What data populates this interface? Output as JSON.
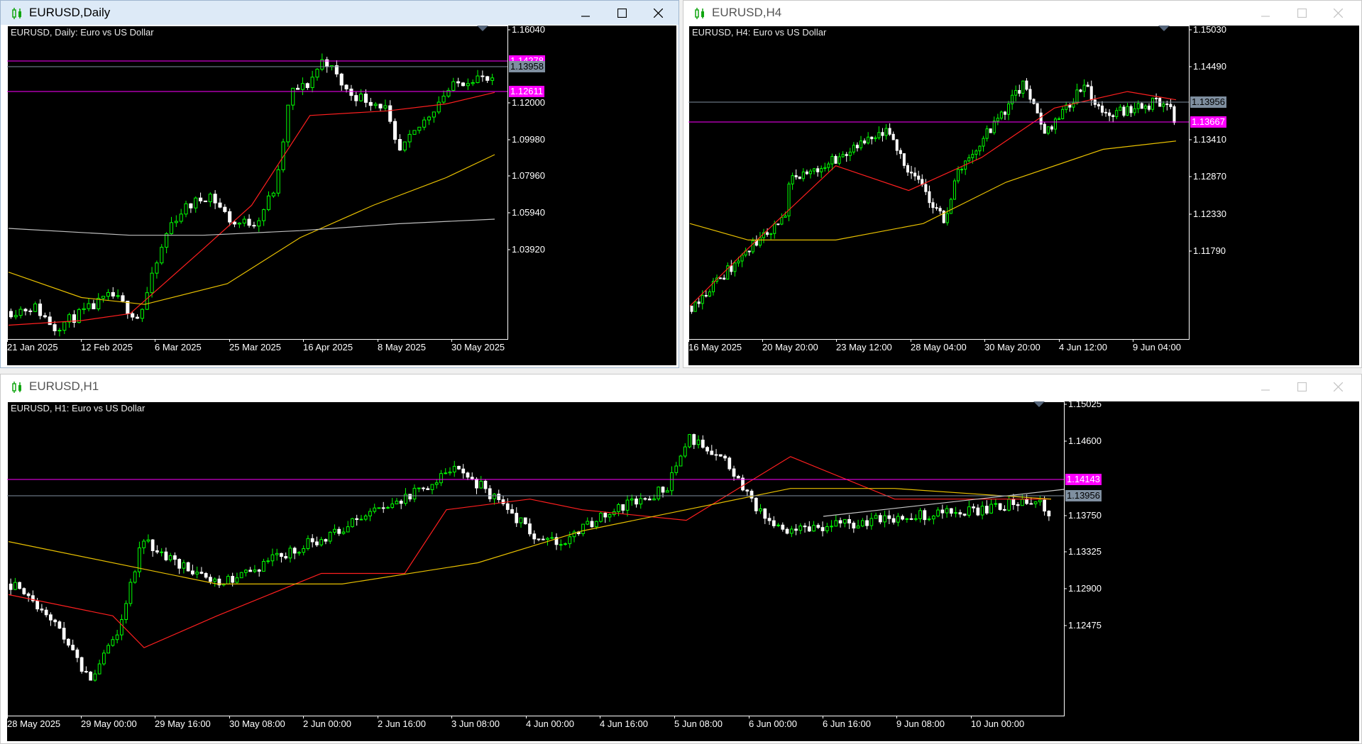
{
  "windows": [
    {
      "id": "daily",
      "state": "active",
      "title": "EURUSD,Daily",
      "chart_title": "EURUSD, Daily:  Euro vs US Dollar",
      "price_labels": [
        "1.16040",
        "1.12000",
        "1.09980",
        "1.07960",
        "1.05940",
        "1.03920"
      ],
      "time_labels": [
        "21 Jan 2025",
        "12 Feb 2025",
        "6 Mar 2025",
        "25 Mar 2025",
        "16 Apr 2025",
        "8 May 2025",
        "30 May 2025"
      ],
      "hlines": [
        {
          "label": "1.14278",
          "color": "#ff00ff"
        },
        {
          "label": "1.13958",
          "color": "#7f8fa0"
        },
        {
          "label": "1.12611",
          "color": "#ff00ff"
        }
      ]
    },
    {
      "id": "h4",
      "state": "inactive",
      "title": "EURUSD,H4",
      "chart_title": "EURUSD, H4:  Euro vs US Dollar",
      "price_labels": [
        "1.15030",
        "1.14490",
        "1.13410",
        "1.12870",
        "1.12330",
        "1.11790"
      ],
      "time_labels": [
        "16 May 2025",
        "20 May 20:00",
        "23 May 12:00",
        "28 May 04:00",
        "30 May 20:00",
        "4 Jun 12:00",
        "9 Jun 04:00"
      ],
      "hlines": [
        {
          "label": "1.13956",
          "color": "#7f8fa0"
        },
        {
          "label": "1.13667",
          "color": "#ff00ff"
        }
      ]
    },
    {
      "id": "h1",
      "state": "inactive",
      "title": "EURUSD,H1",
      "chart_title": "EURUSD, H1:  Euro vs US Dollar",
      "price_labels": [
        "1.15025",
        "1.14600",
        "1.13750",
        "1.13325",
        "1.12900",
        "1.12475"
      ],
      "time_labels": [
        "28 May 2025",
        "29 May 00:00",
        "29 May 16:00",
        "30 May 08:00",
        "2 Jun 00:00",
        "2 Jun 16:00",
        "3 Jun 08:00",
        "4 Jun 00:00",
        "4 Jun 16:00",
        "5 Jun 08:00",
        "6 Jun 00:00",
        "6 Jun 16:00",
        "9 Jun 08:00",
        "10 Jun 00:00"
      ],
      "hlines": [
        {
          "label": "1.14143",
          "color": "#ff00ff"
        },
        {
          "label": "1.13956",
          "color": "#7f8fa0"
        }
      ]
    }
  ],
  "colors": {
    "bull_candle": "#00ff00",
    "bear_candle": "#ffffff",
    "ma_fast": "#ff1f1f",
    "ma_mid": "#e8c000",
    "ma_slow": "#bfbfbf",
    "chart_bg": "#000000",
    "trendline": "#c8c8c8"
  },
  "icons": {
    "app_icon": "candlestick-chart-icon",
    "minimize": "minimize-icon",
    "maximize": "maximize-icon",
    "close": "close-icon"
  },
  "chart_data": [
    {
      "type": "line",
      "chart_kind": "candlestick",
      "symbol": "EURUSD",
      "timeframe": "Daily",
      "title": "EURUSD, Daily:  Euro vs US Dollar",
      "x_range": [
        "21 Jan 2025",
        "9 Jun 2025"
      ],
      "ylim": [
        1.029,
        1.165
      ],
      "close_path": [
        [
          "21 Jan 2025",
          1.041
        ],
        [
          "28 Jan 2025",
          1.043
        ],
        [
          "3 Feb 2025",
          1.034
        ],
        [
          "12 Feb 2025",
          1.041
        ],
        [
          "20 Feb 2025",
          1.048
        ],
        [
          "28 Feb 2025",
          1.038
        ],
        [
          "6 Mar 2025",
          1.078
        ],
        [
          "10 Mar 2025",
          1.085
        ],
        [
          "18 Mar 2025",
          1.092
        ],
        [
          "25 Mar 2025",
          1.079
        ],
        [
          "1 Apr 2025",
          1.08
        ],
        [
          "7 Apr 2025",
          1.096
        ],
        [
          "11 Apr 2025",
          1.136
        ],
        [
          "16 Apr 2025",
          1.139
        ],
        [
          "21 Apr 2025",
          1.151
        ],
        [
          "28 Apr 2025",
          1.136
        ],
        [
          "8 May 2025",
          1.13
        ],
        [
          "12 May 2025",
          1.109
        ],
        [
          "20 May 2025",
          1.124
        ],
        [
          "26 May 2025",
          1.136
        ],
        [
          "30 May 2025",
          1.14
        ],
        [
          "4 Jun 2025",
          1.143
        ],
        [
          "9 Jun 2025",
          1.14
        ]
      ],
      "series": [
        {
          "name": "MA fast (red)",
          "color": "#ff1f1f",
          "values": [
            [
              0,
              1.035
            ],
            [
              0.15,
              1.037
            ],
            [
              0.25,
              1.04
            ],
            [
              0.4,
              1.068
            ],
            [
              0.5,
              1.087
            ],
            [
              0.62,
              1.126
            ],
            [
              0.78,
              1.128
            ],
            [
              0.9,
              1.131
            ],
            [
              1.0,
              1.136
            ]
          ]
        },
        {
          "name": "MA mid (yellow)",
          "color": "#e8c000",
          "values": [
            [
              0,
              1.058
            ],
            [
              0.15,
              1.047
            ],
            [
              0.28,
              1.044
            ],
            [
              0.45,
              1.053
            ],
            [
              0.6,
              1.073
            ],
            [
              0.75,
              1.087
            ],
            [
              0.9,
              1.099
            ],
            [
              1.0,
              1.109
            ]
          ]
        },
        {
          "name": "MA slow (gray)",
          "color": "#bfbfbf",
          "values": [
            [
              0,
              1.077
            ],
            [
              0.25,
              1.074
            ],
            [
              0.4,
              1.074
            ],
            [
              0.6,
              1.076
            ],
            [
              0.8,
              1.079
            ],
            [
              1.0,
              1.081
            ]
          ]
        }
      ],
      "horizontal_lines": [
        1.14278,
        1.13958,
        1.12611
      ]
    },
    {
      "type": "line",
      "chart_kind": "candlestick",
      "symbol": "EURUSD",
      "timeframe": "H4",
      "title": "EURUSD, H4:  Euro vs US Dollar",
      "x_range": [
        "16 May 2025",
        "9 Jun 2025 16:00"
      ],
      "ylim": [
        1.113,
        1.151
      ],
      "close_path": [
        [
          "16 May 2025",
          1.117
        ],
        [
          "19 May 2025",
          1.124
        ],
        [
          "20 May 20:00",
          1.128
        ],
        [
          "21 May 2025",
          1.132
        ],
        [
          "23 May 12:00",
          1.135
        ],
        [
          "26 May 2025",
          1.138
        ],
        [
          "27 May 2025",
          1.134
        ],
        [
          "28 May 04:00",
          1.13
        ],
        [
          "29 May 2025",
          1.127
        ],
        [
          "29 May 12:00",
          1.133
        ],
        [
          "30 May 20:00",
          1.137
        ],
        [
          "2 Jun 2025",
          1.144
        ],
        [
          "3 Jun 2025",
          1.138
        ],
        [
          "4 Jun 12:00",
          1.142
        ],
        [
          "5 Jun 2025",
          1.144
        ],
        [
          "6 Jun 2025",
          1.14
        ],
        [
          "9 Jun 04:00",
          1.142
        ],
        [
          "9 Jun 16:00",
          1.1397
        ]
      ],
      "series": [
        {
          "name": "MA fast (red)",
          "color": "#ff1f1f",
          "values": [
            [
              0,
              1.117
            ],
            [
              0.12,
              1.124
            ],
            [
              0.3,
              1.134
            ],
            [
              0.45,
              1.131
            ],
            [
              0.6,
              1.135
            ],
            [
              0.75,
              1.141
            ],
            [
              0.9,
              1.143
            ],
            [
              1.0,
              1.142
            ]
          ]
        },
        {
          "name": "MA mid (yellow)",
          "color": "#e8c000",
          "values": [
            [
              0,
              1.127
            ],
            [
              0.12,
              1.125
            ],
            [
              0.3,
              1.125
            ],
            [
              0.48,
              1.127
            ],
            [
              0.65,
              1.132
            ],
            [
              0.85,
              1.136
            ],
            [
              1.0,
              1.137
            ]
          ]
        }
      ],
      "horizontal_lines": [
        1.13956,
        1.13667
      ]
    },
    {
      "type": "line",
      "chart_kind": "candlestick",
      "symbol": "EURUSD",
      "timeframe": "H1",
      "title": "EURUSD, H1:  Euro vs US Dollar",
      "x_range": [
        "28 May 2025",
        "10 Jun 2025 04:00"
      ],
      "ylim": [
        1.1206,
        1.1502
      ],
      "close_path": [
        [
          "28 May 2025",
          1.133
        ],
        [
          "28 May 12:00",
          1.13
        ],
        [
          "29 May 00:00",
          1.124
        ],
        [
          "29 May 08:00",
          1.128
        ],
        [
          "29 May 16:00",
          1.137
        ],
        [
          "30 May 08:00",
          1.134
        ],
        [
          "30 May 16:00",
          1.133
        ],
        [
          "2 Jun 00:00",
          1.141
        ],
        [
          "2 Jun 16:00",
          1.144
        ],
        [
          "3 Jun 08:00",
          1.14
        ],
        [
          "3 Jun 16:00",
          1.137
        ],
        [
          "4 Jun 00:00",
          1.137
        ],
        [
          "4 Jun 16:00",
          1.14
        ],
        [
          "5 Jun 08:00",
          1.142
        ],
        [
          "5 Jun 14:00",
          1.147
        ],
        [
          "6 Jun 00:00",
          1.145
        ],
        [
          "6 Jun 16:00",
          1.138
        ],
        [
          "9 Jun 08:00",
          1.14
        ],
        [
          "10 Jun 00:00",
          1.141
        ],
        [
          "10 Jun 04:00",
          1.1396
        ]
      ],
      "series": [
        {
          "name": "MA fast (red)",
          "color": "#ff1f1f",
          "values": [
            [
              0,
              1.132
            ],
            [
              0.1,
              1.13
            ],
            [
              0.13,
              1.127
            ],
            [
              0.2,
              1.13
            ],
            [
              0.3,
              1.134
            ],
            [
              0.38,
              1.134
            ],
            [
              0.42,
              1.14
            ],
            [
              0.5,
              1.141
            ],
            [
              0.55,
              1.14
            ],
            [
              0.65,
              1.139
            ],
            [
              0.75,
              1.145
            ],
            [
              0.85,
              1.141
            ],
            [
              0.95,
              1.141
            ],
            [
              1.0,
              1.141
            ]
          ]
        },
        {
          "name": "MA mid (yellow)",
          "color": "#e8c000",
          "values": [
            [
              0,
              1.137
            ],
            [
              0.2,
              1.133
            ],
            [
              0.32,
              1.133
            ],
            [
              0.45,
              1.135
            ],
            [
              0.55,
              1.138
            ],
            [
              0.65,
              1.14
            ],
            [
              0.75,
              1.142
            ],
            [
              0.85,
              1.142
            ],
            [
              1.0,
              1.141
            ]
          ]
        }
      ],
      "horizontal_lines": [
        1.14143,
        1.13956
      ]
    }
  ]
}
